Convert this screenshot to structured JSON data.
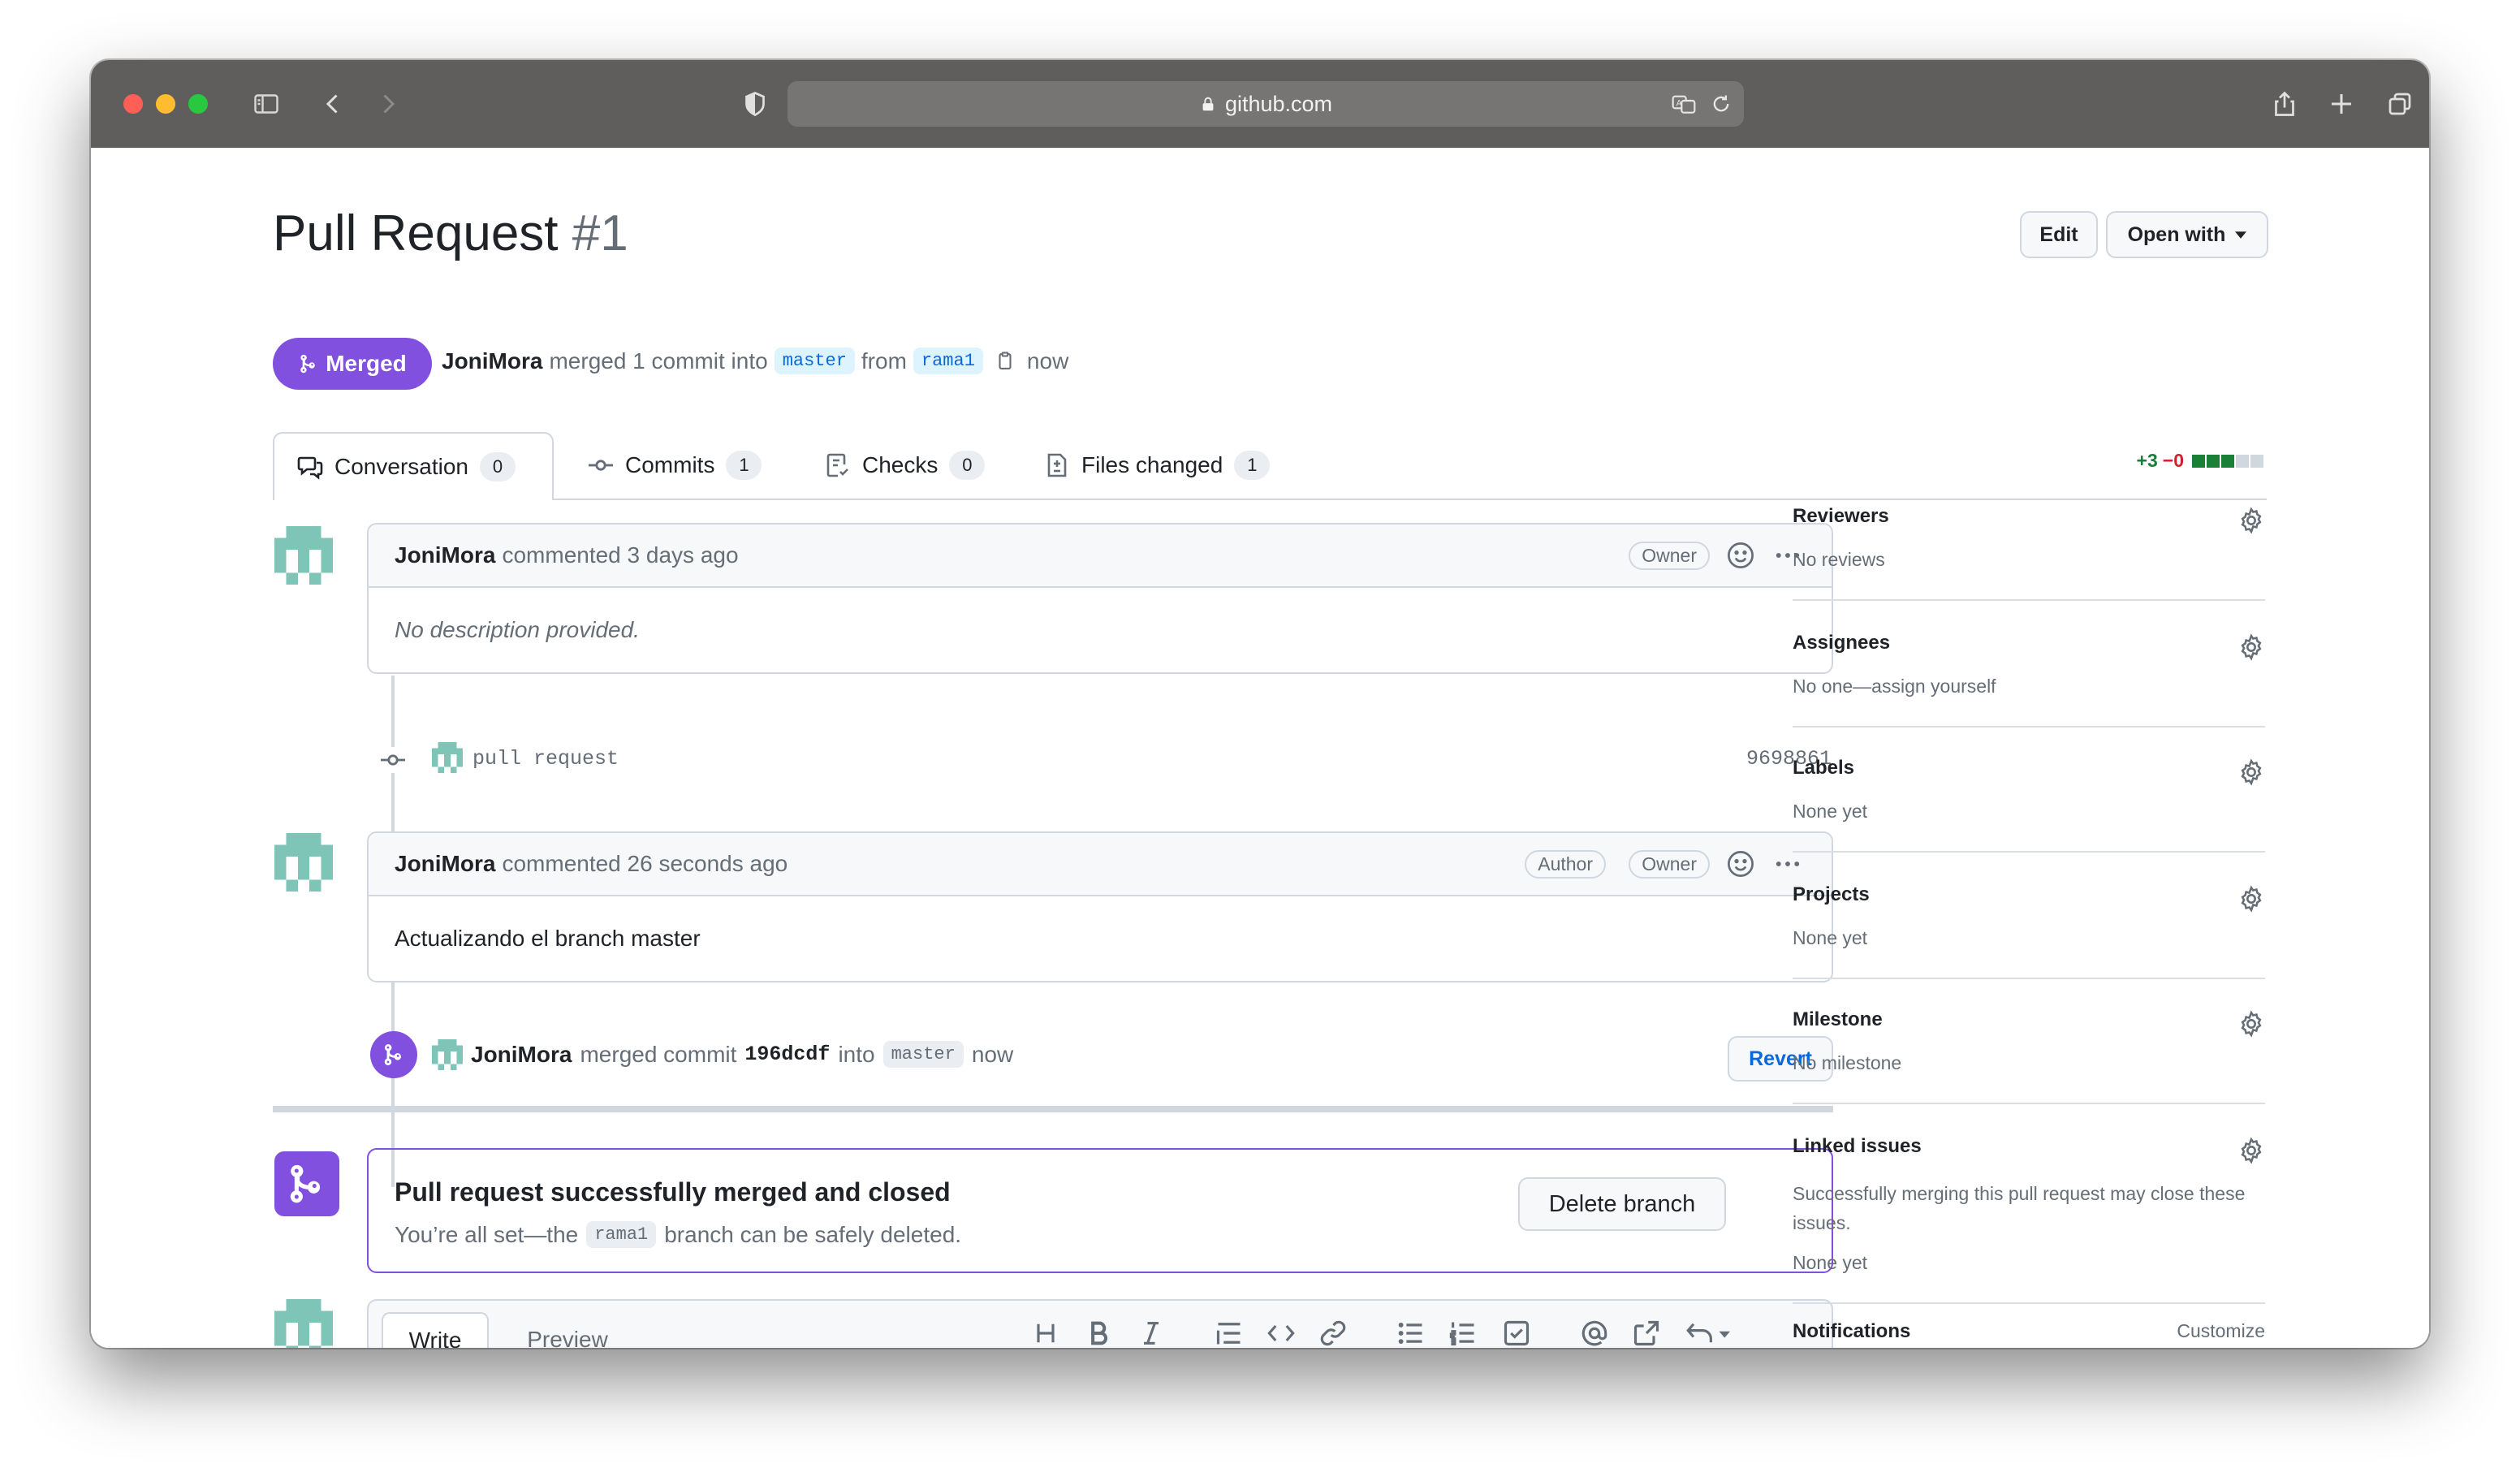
{
  "browser": {
    "url": "github.com"
  },
  "pr": {
    "title": "Pull Request",
    "number": "#1",
    "state": "Merged",
    "author": "JoniMora",
    "merged_text": "merged 1 commit into",
    "base_branch": "master",
    "from_text": "from",
    "head_branch": "rama1",
    "time": "now",
    "edit_label": "Edit",
    "open_with_label": "Open with"
  },
  "tabs": [
    {
      "label": "Conversation",
      "count": "0"
    },
    {
      "label": "Commits",
      "count": "1"
    },
    {
      "label": "Checks",
      "count": "0"
    },
    {
      "label": "Files changed",
      "count": "1"
    }
  ],
  "diffstat": {
    "added": "+3",
    "removed": "−0"
  },
  "comments": [
    {
      "author": "JoniMora",
      "action": "commented 3 days ago",
      "badges": [
        "Owner"
      ],
      "body": "No description provided."
    },
    {
      "author": "JoniMora",
      "action": "commented 26 seconds ago",
      "badges": [
        "Author",
        "Owner"
      ],
      "body": "Actualizando el branch master"
    }
  ],
  "commit_event": {
    "message": "pull request",
    "sha": "9698861"
  },
  "merge_event": {
    "author": "JoniMora",
    "text1": "merged commit",
    "sha": "196dcdf",
    "text2": "into",
    "branch": "master",
    "time": "now",
    "revert_label": "Revert"
  },
  "merged_box": {
    "title": "Pull request successfully merged and closed",
    "text_before": "You’re all set—the",
    "branch": "rama1",
    "text_after": "branch can be safely deleted.",
    "delete_label": "Delete branch"
  },
  "editor": {
    "write_tab": "Write",
    "preview_tab": "Preview",
    "tools": [
      "heading-icon",
      "bold-icon",
      "italic-icon",
      "quote-icon",
      "code-icon",
      "link-icon",
      "bullet-list-icon",
      "numbered-list-icon",
      "task-list-icon",
      "mention-icon",
      "reference-icon",
      "undo-icon"
    ]
  },
  "sidebar": {
    "reviewers": {
      "title": "Reviewers",
      "value": "No reviews"
    },
    "assignees": {
      "title": "Assignees",
      "value": "No one—assign yourself"
    },
    "labels": {
      "title": "Labels",
      "value": "None yet"
    },
    "projects": {
      "title": "Projects",
      "value": "None yet"
    },
    "milestone": {
      "title": "Milestone",
      "value": "No milestone"
    },
    "linked": {
      "title": "Linked issues",
      "value": "Successfully merging this pull request may close these issues.",
      "value2": "None yet"
    },
    "notifications": {
      "title": "Notifications",
      "action": "Customize"
    }
  },
  "colors": {
    "merged": "#8250df",
    "link": "#0969da",
    "added": "#1a7f37",
    "removed": "#cf222e"
  }
}
